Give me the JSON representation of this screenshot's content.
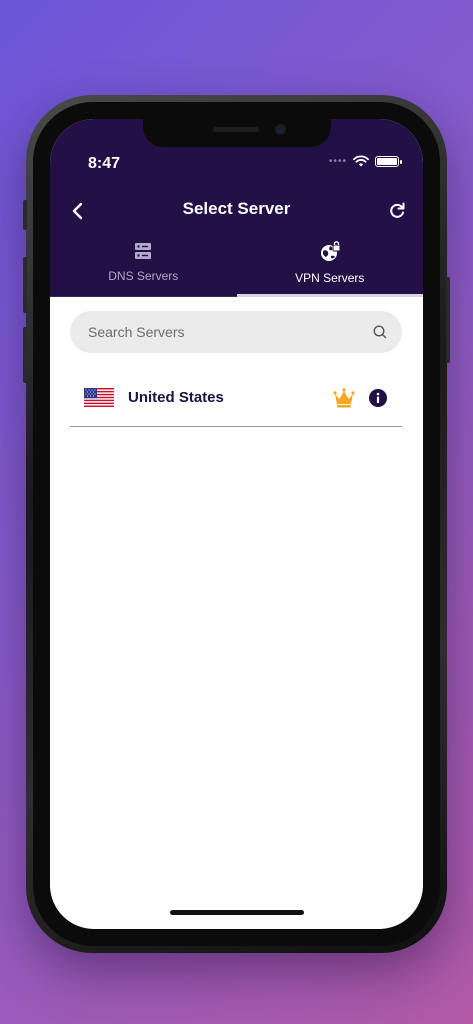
{
  "status_bar": {
    "time": "8:47"
  },
  "nav": {
    "title": "Select Server",
    "back_icon": "chevron-left-icon",
    "refresh_icon": "refresh-icon"
  },
  "tabs": [
    {
      "label": "DNS Servers",
      "icon": "server-icon",
      "active": false
    },
    {
      "label": "VPN Servers",
      "icon": "globe-lock-icon",
      "active": true
    }
  ],
  "search": {
    "placeholder": "Search Servers",
    "value": ""
  },
  "servers": [
    {
      "name": "United States",
      "flag": "us-flag-icon",
      "premium": true
    }
  ],
  "colors": {
    "header": "#221046",
    "premium": "#f5a623",
    "text_dark": "#1d1240"
  }
}
